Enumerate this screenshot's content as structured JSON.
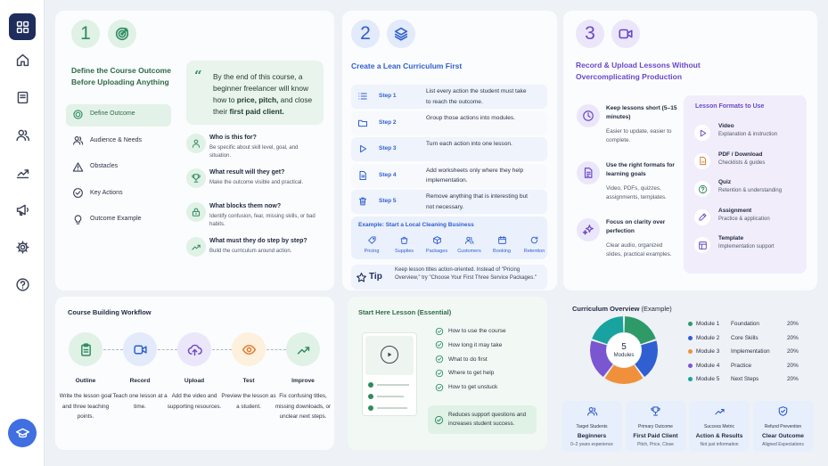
{
  "colors": {
    "green": "#2e8b60",
    "blue": "#2f5fd0",
    "purple": "#6a48c8",
    "orange": "#e07b2f"
  },
  "sidebar": {
    "items": [
      {
        "icon": "grid-icon",
        "active": true
      },
      {
        "icon": "home-icon"
      },
      {
        "icon": "book-icon"
      },
      {
        "icon": "users-icon"
      },
      {
        "icon": "chart-icon"
      },
      {
        "icon": "megaphone-icon"
      },
      {
        "icon": "gear-icon"
      },
      {
        "icon": "help-icon"
      },
      {
        "icon": "graduation-cap-icon"
      }
    ]
  },
  "step1": {
    "number": "1",
    "title": "Define the Course Outcome Before Uploading Anything",
    "nav": [
      {
        "label": "Define Outcome",
        "icon": "target-icon",
        "active": true
      },
      {
        "label": "Audience & Needs",
        "icon": "users-icon"
      },
      {
        "label": "Obstacles",
        "icon": "warning-icon"
      },
      {
        "label": "Key Actions",
        "icon": "check-circle-icon"
      },
      {
        "label": "Outcome Example",
        "icon": "lightbulb-icon"
      }
    ],
    "quote_pre": "By the end of this course, a beginner freelancer will know how to ",
    "quote_bold": "price, pitch, ",
    "quote_mid": "and close their ",
    "quote_bold2": "first paid client.",
    "questions": [
      {
        "q": "Who is this for?",
        "a": "Be specific about skill level, goal, and situation.",
        "icon": "person-icon"
      },
      {
        "q": "What result will they get?",
        "a": "Make the outcome visible and practical.",
        "icon": "trophy-icon"
      },
      {
        "q": "What blocks them now?",
        "a": "Identify confusion, fear, missing skills, or bad habits.",
        "icon": "lock-icon"
      },
      {
        "q": "What must they do step by step?",
        "a": "Build the curriculum around action.",
        "icon": "trend-icon"
      }
    ]
  },
  "step2": {
    "number": "2",
    "title": "Create a Lean Curriculum First",
    "steps": [
      {
        "label": "Step 1",
        "text": "List every action the student must take to reach the outcome.",
        "icon": "list-icon"
      },
      {
        "label": "Step 2",
        "text": "Group those actions into modules.",
        "icon": "folder-icon"
      },
      {
        "label": "Step 3",
        "text": "Turn each action into one lesson.",
        "icon": "play-icon"
      },
      {
        "label": "Step 4",
        "text": "Add worksheets only where they help implementation.",
        "icon": "document-icon"
      },
      {
        "label": "Step 5",
        "text": "Remove anything that is interesting but not necessary.",
        "icon": "trash-icon"
      }
    ],
    "example_title": "Example: Start a Local Cleaning Business",
    "example_items": [
      "Pricing",
      "Supplies",
      "Packages",
      "Customers",
      "Booking",
      "Retention"
    ],
    "tip_label": "Tip",
    "tip_text": "Keep lesson titles action-oriented. Instead of \"Pricing Overview,\" try \"Choose Your First Three Service Packages.\""
  },
  "step3": {
    "number": "3",
    "title": "Record & Upload Lessons Without Overcomplicating Production",
    "points": [
      {
        "title": "Keep lessons short (5–15 minutes)",
        "text": "Easier to update, easier to complete.",
        "icon": "clock-icon"
      },
      {
        "title": "Use the right formats for learning goals",
        "text": "Video, PDFs, quizzes, assignments, templates.",
        "icon": "file-icon"
      },
      {
        "title": "Focus on clarity over perfection",
        "text": "Clear audio, organized slides, practical examples.",
        "icon": "sparkle-icon"
      }
    ],
    "formats_title": "Lesson Formats to Use",
    "formats": [
      {
        "name": "Video",
        "desc": "Explanation & instruction",
        "icon": "video-play-icon"
      },
      {
        "name": "PDF / Download",
        "desc": "Checklists & guides",
        "icon": "pdf-icon"
      },
      {
        "name": "Quiz",
        "desc": "Retention & understanding",
        "icon": "quiz-icon"
      },
      {
        "name": "Assignment",
        "desc": "Practice & application",
        "icon": "pencil-icon"
      },
      {
        "name": "Template",
        "desc": "Implementation support",
        "icon": "template-icon"
      }
    ]
  },
  "workflow": {
    "title": "Course Building Workflow",
    "steps": [
      {
        "name": "Outline",
        "desc": "Write the lesson goal and three teaching points.",
        "icon": "clipboard-icon"
      },
      {
        "name": "Record",
        "desc": "Teach one lesson at a time.",
        "icon": "camera-icon"
      },
      {
        "name": "Upload",
        "desc": "Add the video and supporting resources.",
        "icon": "upload-cloud-icon"
      },
      {
        "name": "Test",
        "desc": "Preview the lesson as a student.",
        "icon": "eye-icon"
      },
      {
        "name": "Improve",
        "desc": "Fix confusing titles, missing downloads, or unclear next steps.",
        "icon": "trend-up-icon"
      }
    ]
  },
  "start_here": {
    "title": "Start Here Lesson (Essential)",
    "items": [
      "How to use the course",
      "How long it may take",
      "What to do first",
      "Where to get help",
      "How to get unstuck"
    ],
    "note": "Reduces support questions and increases student success."
  },
  "chart_data": {
    "type": "pie",
    "title": "Curriculum Overview",
    "subtitle": "(Example)",
    "center_value": "5",
    "center_label": "Modules",
    "categories": [
      "Module 1",
      "Module 2",
      "Module 3",
      "Module 4",
      "Module 5"
    ],
    "series_labels": [
      "Foundation",
      "Core Skills",
      "Implementation",
      "Practice",
      "Next Steps"
    ],
    "values": [
      20,
      20,
      20,
      20,
      20
    ],
    "value_labels": [
      "20%",
      "20%",
      "20%",
      "20%",
      "20%"
    ],
    "colors": [
      "#2e9a68",
      "#2f5fd0",
      "#f0903a",
      "#7a56d0",
      "#18a3a0"
    ]
  },
  "stats": [
    {
      "label": "Target Students",
      "value": "Beginners",
      "sub": "0–2 years experience",
      "icon": "users-icon"
    },
    {
      "label": "Primary Outcome",
      "value": "First Paid Client",
      "sub": "Pitch, Price, Close",
      "icon": "trophy-icon"
    },
    {
      "label": "Success Metric",
      "value": "Action & Results",
      "sub": "Not just information",
      "icon": "trend-icon"
    },
    {
      "label": "Refund Prevention",
      "value": "Clear Outcome",
      "sub": "Aligned Expectations",
      "icon": "shield-check-icon"
    }
  ]
}
